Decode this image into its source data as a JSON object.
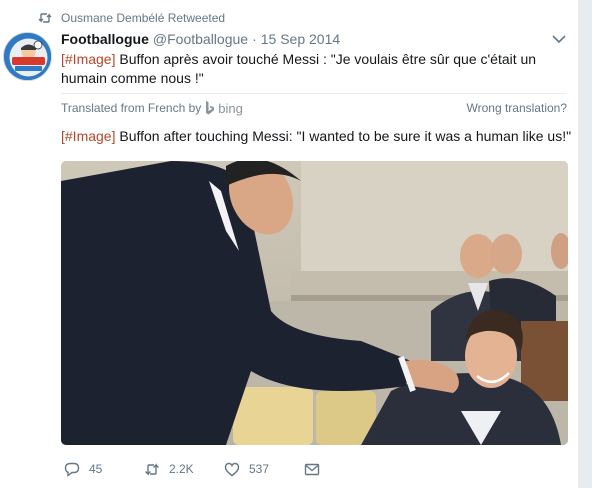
{
  "retweet_context": {
    "icon": "retweet-icon",
    "text": "Ousmane Dembélé Retweeted"
  },
  "tweet": {
    "avatar_text": "FOOTBALLOGUE",
    "fullname": "Footballogue",
    "handle": "@Footballogue",
    "separator": "·",
    "timestamp": "15 Sep 2014",
    "original_hashtag": "[#Image]",
    "original_text": " Buffon après avoir touché Messi : \"Je voulais être sûr que c'était un humain comme nous !\"",
    "translation": {
      "label": "Translated from French by",
      "provider": "bing",
      "wrong_label": "Wrong translation?"
    },
    "translated_hashtag": "[#Image]",
    "translated_text": " Buffon after touching Messi: \"I wanted to be sure it was a human like us!\"",
    "photo_alt": "Gianluigi Buffon leaning over to touch Lionel Messi's face"
  },
  "actions": {
    "reply_count": "45",
    "retweet_count": "2.2K",
    "like_count": "537"
  },
  "colors": {
    "secondary_text": "#657786",
    "hashtag": "#b5462b",
    "divider": "#e6ecf0"
  }
}
